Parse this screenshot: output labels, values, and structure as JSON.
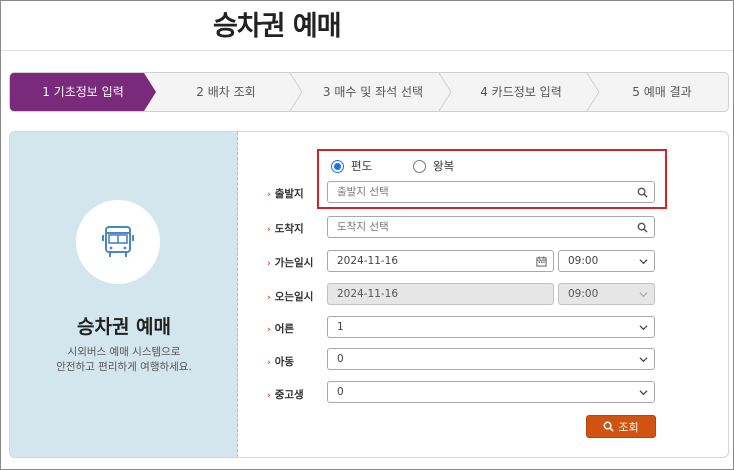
{
  "page": {
    "title": "승차권 예매"
  },
  "steps": [
    {
      "label": "1 기초정보 입력",
      "active": true
    },
    {
      "label": "2 배차 조회",
      "active": false
    },
    {
      "label": "3 매수 및 좌석 선택",
      "active": false
    },
    {
      "label": "4 카드정보 입력",
      "active": false
    },
    {
      "label": "5 예매 결과",
      "active": false
    }
  ],
  "side": {
    "icon": "bus-icon",
    "title": "승차권 예매",
    "desc_line1": "시외버스 예매 시스템으로",
    "desc_line2": "안전하고 편리하게 여행하세요."
  },
  "trip_type": {
    "one_way": "편도",
    "round_trip": "왕복",
    "selected": "one_way"
  },
  "form": {
    "departure": {
      "label": "출발지",
      "placeholder": "출발지 선택"
    },
    "arrival": {
      "label": "도착지",
      "placeholder": "도착지 선택"
    },
    "go_date": {
      "label": "가는일시",
      "date": "2024-11-16",
      "time": "09:00"
    },
    "return_date": {
      "label": "오는일시",
      "date": "2024-11-16",
      "time": "09:00"
    },
    "adult": {
      "label": "어른",
      "value": "1"
    },
    "child": {
      "label": "아동",
      "value": "0"
    },
    "student": {
      "label": "중고생",
      "value": "0"
    }
  },
  "search_button": {
    "label": "조회",
    "icon": "search-icon"
  },
  "colors": {
    "step_active": "#7a2a7a",
    "side_bg": "#d3e6ee",
    "accent": "#d05312",
    "highlight_border": "#d0232b"
  }
}
